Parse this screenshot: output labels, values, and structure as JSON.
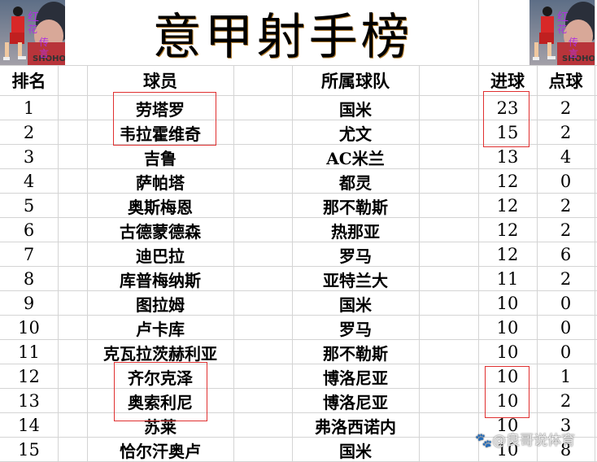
{
  "title": "意甲射手榜",
  "columns": {
    "rank": "排名",
    "player": "球员",
    "team": "所属球队",
    "goals": "进球",
    "penalties": "点球"
  },
  "rows": [
    {
      "rank": "1",
      "player": "劳塔罗",
      "team": "国米",
      "goals": "23",
      "penalties": "2"
    },
    {
      "rank": "2",
      "player": "韦拉霍维奇",
      "team": "尤文",
      "goals": "15",
      "penalties": "2"
    },
    {
      "rank": "3",
      "player": "吉鲁",
      "team": "AC米兰",
      "goals": "13",
      "penalties": "4"
    },
    {
      "rank": "4",
      "player": "萨帕塔",
      "team": "都灵",
      "goals": "12",
      "penalties": "0"
    },
    {
      "rank": "5",
      "player": "奥斯梅恩",
      "team": "那不勒斯",
      "goals": "12",
      "penalties": "2"
    },
    {
      "rank": "6",
      "player": "古德蒙德森",
      "team": "热那亚",
      "goals": "12",
      "penalties": "2"
    },
    {
      "rank": "7",
      "player": "迪巴拉",
      "team": "罗马",
      "goals": "12",
      "penalties": "6"
    },
    {
      "rank": "8",
      "player": "库普梅纳斯",
      "team": "亚特兰大",
      "goals": "11",
      "penalties": "2"
    },
    {
      "rank": "9",
      "player": "图拉姆",
      "team": "国米",
      "goals": "10",
      "penalties": "0"
    },
    {
      "rank": "10",
      "player": "卢卡库",
      "team": "罗马",
      "goals": "10",
      "penalties": "0"
    },
    {
      "rank": "11",
      "player": "克瓦拉茨赫利亚",
      "team": "那不勒斯",
      "goals": "10",
      "penalties": "0"
    },
    {
      "rank": "12",
      "player": "齐尔克泽",
      "team": "博洛尼亚",
      "goals": "10",
      "penalties": "1"
    },
    {
      "rank": "13",
      "player": "奥索利尼",
      "team": "博洛尼亚",
      "goals": "10",
      "penalties": "2"
    },
    {
      "rank": "14",
      "player": "苏莱",
      "team": "弗洛西诺内",
      "goals": "10",
      "penalties": "3"
    },
    {
      "rank": "15",
      "player": "恰尔汗奥卢",
      "team": "国米",
      "goals": "10",
      "penalties": "8"
    }
  ],
  "thumbnails": {
    "left": "basketball-player-image",
    "right": "basketball-player-image"
  },
  "watermark": "@良哥说体育",
  "colors": {
    "highlight_box": "#e03030",
    "grid": "#d4d4d4",
    "thumbnail_text": "#b030e0"
  }
}
